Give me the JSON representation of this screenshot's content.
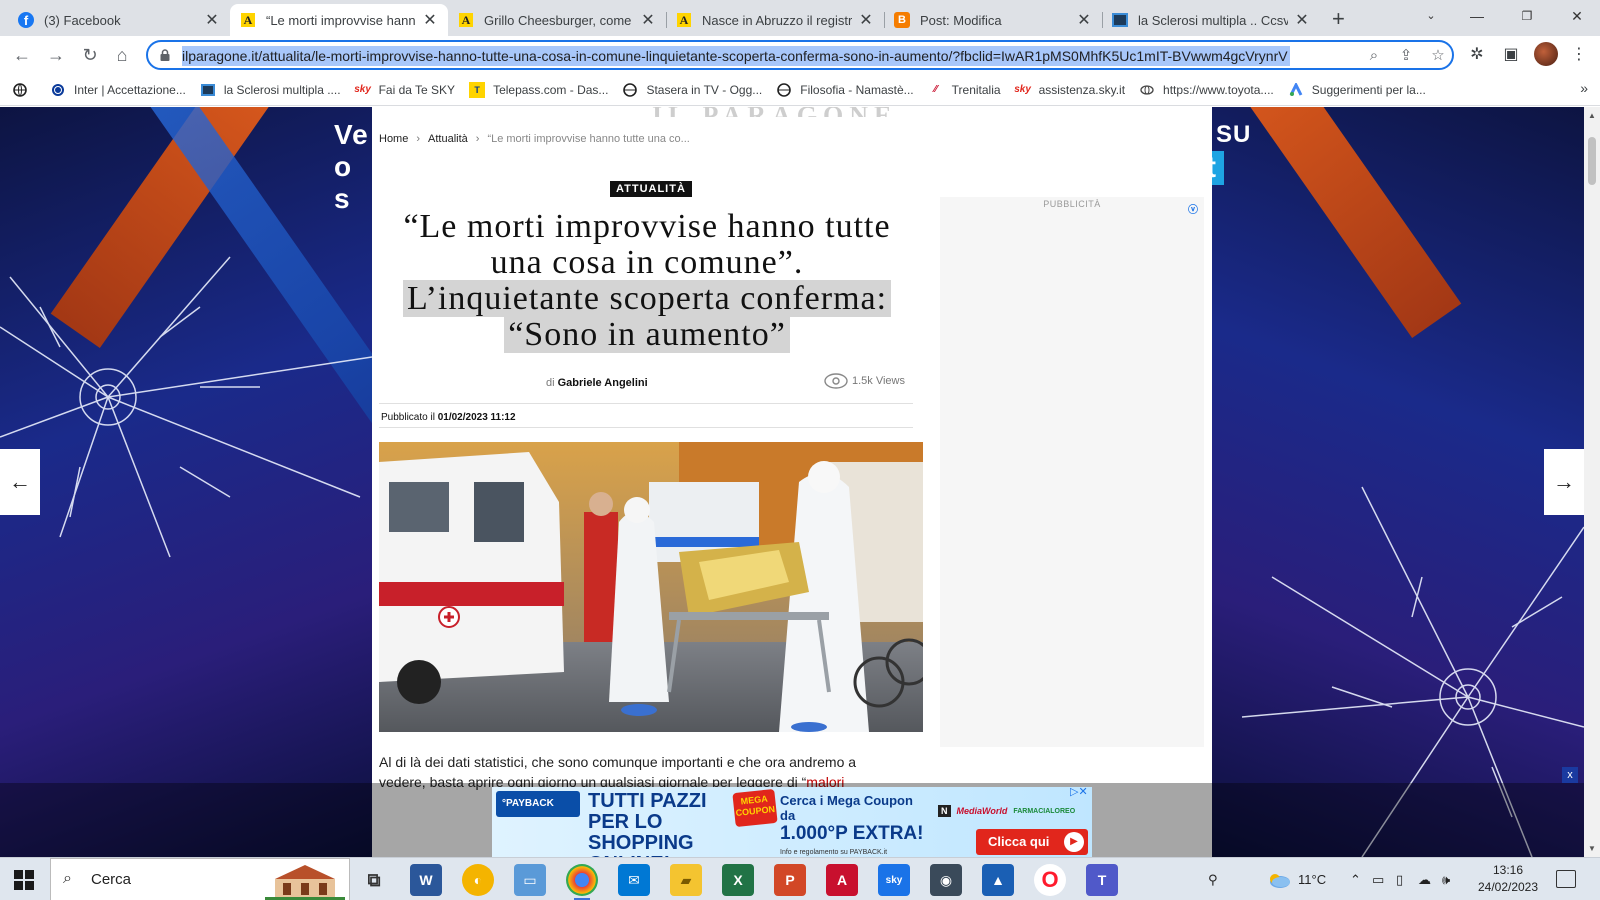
{
  "browser": {
    "tabs": [
      {
        "title": "(3) Facebook",
        "favicon": "facebook-icon",
        "active": false
      },
      {
        "title": "“Le morti improvvise hanno",
        "favicon": "ilparagone-icon",
        "active": true
      },
      {
        "title": "Grillo Cheesburger, come ri",
        "favicon": "ilparagone-icon",
        "active": false
      },
      {
        "title": "Nasce in Abruzzo il registro",
        "favicon": "ilparagone-icon",
        "active": false
      },
      {
        "title": "Post: Modifica",
        "favicon": "blogger-icon",
        "active": false
      },
      {
        "title": "la Sclerosi multipla .. Ccsvi",
        "favicon": "ccsvi-icon",
        "active": false
      }
    ],
    "new_tab_glyph": "+",
    "url": "ilparagone.it/attualita/le-morti-improvvise-hanno-tutte-una-cosa-in-comune-linquietante-scoperta-conferma-sono-in-aumento/?fbclid=IwAR1pMS0MhfK5Uc1mIT-BVwwm4gcVrynrV",
    "bookmarks": [
      {
        "label": "",
        "icon": "globe-icon"
      },
      {
        "label": "Inter | Accettazione...",
        "icon": "inter-icon"
      },
      {
        "label": "la Sclerosi multipla ....",
        "icon": "ccsvi-icon"
      },
      {
        "label": "Fai da Te SKY",
        "icon": "sky-icon"
      },
      {
        "label": "Telepass.com - Das...",
        "icon": "telepass-icon"
      },
      {
        "label": "Stasera in TV - Ogg...",
        "icon": "globe-icon"
      },
      {
        "label": "Filosofia - Namastè...",
        "icon": "globe-icon"
      },
      {
        "label": "Trenitalia",
        "icon": "trenitalia-icon"
      },
      {
        "label": "assistenza.sky.it",
        "icon": "sky-icon"
      },
      {
        "label": "https://www.toyota....",
        "icon": "toyota-icon"
      },
      {
        "label": "Suggerimenti per la...",
        "icon": "google-ads-icon"
      }
    ],
    "more_bookmarks_glyph": "»"
  },
  "promo": {
    "left_line1": "Ve",
    "left_line2": "o s",
    "right_line1": "U SU",
    "right_box": "t"
  },
  "article": {
    "breadcrumb": {
      "home": "Home",
      "section": "Attualità",
      "current": "“Le morti improvvise hanno tutte una co..."
    },
    "category": "ATTUALITÀ",
    "headline_part1": "“Le morti improvvise hanno tutte una cosa in comune”.",
    "headline_part2": "L’inquietante scoperta conferma:",
    "headline_part3": "“Sono in aumento”",
    "byline_prefix": "di",
    "author": "Gabriele Angelini",
    "views": "1.5k Views",
    "published_label": "Pubblicato il",
    "published_date": "01/02/2023 11:12",
    "body_line1": "Al di là dei dati statistici, che sono comunque importanti e che ora andremo a",
    "body_line2": "vedere, basta aprire ogni giorno un qualsiasi giornale per leggere di “",
    "body_link": "malori"
  },
  "sidebar_ad": {
    "label": "PUBBLICITÀ"
  },
  "bottom_ad": {
    "brand": "°PAYBACK",
    "headline": "TUTTI PAZZI PER LO SHOPPING ONLINE!",
    "badge": "MEGA COUPON",
    "line1": "Cerca i Mega Coupon da",
    "line2": "1.000°P EXTRA!",
    "fineprint": "Info e regolamento su PAYBACK.it",
    "partner1": "MediaWorld",
    "partner2": "FARMACIALOREO",
    "cta": "Clicca qui",
    "close_glyph": "x"
  },
  "taskbar": {
    "search_placeholder": "Cerca",
    "temperature": "11°C",
    "time": "13:16",
    "date": "24/02/2023"
  },
  "colors": {
    "accent": "#1a73e8",
    "promo_bg": "#1a2a8a",
    "cta_red": "#e1261c"
  }
}
